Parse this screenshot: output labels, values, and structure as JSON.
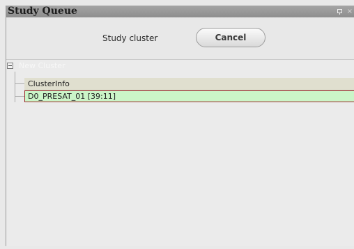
{
  "window": {
    "title": "Study Queue",
    "pin_icon": "pin-icon",
    "close_icon": "close-icon",
    "close_glyph": "×"
  },
  "toolbar": {
    "study_label": "Study cluster",
    "cancel_label": "Cancel"
  },
  "tree": {
    "root": {
      "label": "New Cluster",
      "expanded": true
    },
    "children": [
      {
        "label": "ClusterInfo",
        "selected": false
      },
      {
        "label": "D0_PRESAT_01 [39:11]",
        "selected": true
      }
    ]
  },
  "colors": {
    "titlebar": "#9a9a9a",
    "selected_row": "#cbf5c8",
    "selected_border": "#9a2a2a",
    "info_row": "#e0dfcf"
  }
}
